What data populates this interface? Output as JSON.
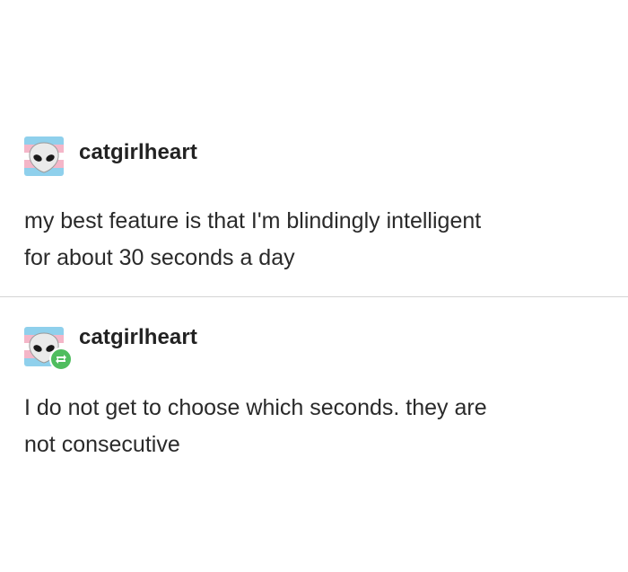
{
  "posts": [
    {
      "username": "catgirlheart",
      "avatar_icon": "alien-face-icon",
      "reblog": false,
      "body": "my best feature is that I'm blindingly intelligent\nfor about 30 seconds a day"
    },
    {
      "username": "catgirlheart",
      "avatar_icon": "alien-face-icon",
      "reblog": true,
      "reblog_icon": "reblog-icon",
      "body": "I do not get to choose which seconds. they are\nnot consecutive"
    }
  ],
  "colors": {
    "flag_blue": "#8fd0ec",
    "flag_pink": "#f4b6c8",
    "flag_white": "#ffffff",
    "reblog_green": "#4fbd5e",
    "divider": "#d4d4d4"
  }
}
